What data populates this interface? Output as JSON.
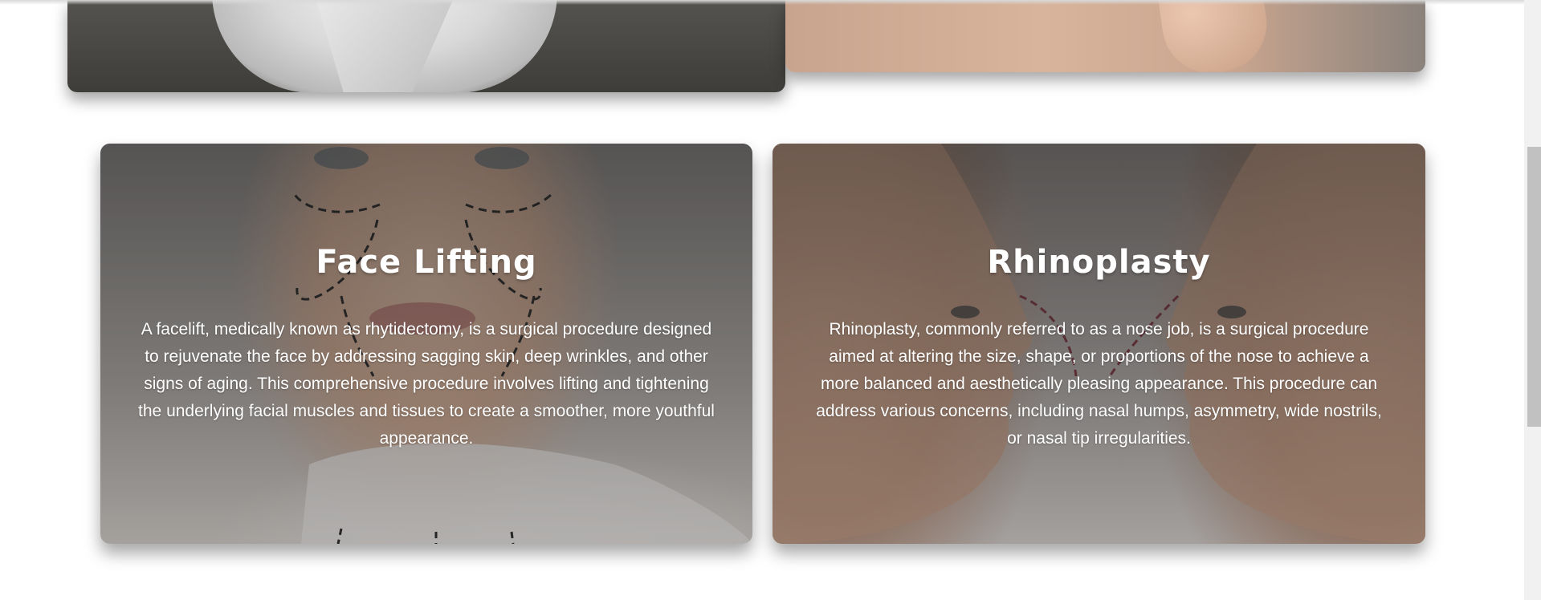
{
  "previous_row": {
    "left_card": {
      "image": "woman-with-towel-photo"
    },
    "right_card": {
      "image": "hand-closeup-photo"
    }
  },
  "cards": [
    {
      "title": "Face Lifting",
      "description": "A facelift, medically known as rhytidectomy, is a surgical procedure designed to rejuvenate the face by addressing sagging skin, deep wrinkles, and other signs of aging. This comprehensive procedure involves lifting and tightening the underlying facial muscles and tissues to create a smoother, more youthful appearance.",
      "image": "face-lift-markings-photo"
    },
    {
      "title": "Rhinoplasty",
      "description": "Rhinoplasty, commonly referred to as a nose job, is a surgical procedure aimed at altering the size, shape, or proportions of the nose to achieve a more balanced and aesthetically pleasing appearance. This procedure can address various concerns, including nasal humps, asymmetry, wide nostrils, or nasal tip irregularities.",
      "image": "two-profiles-nose-photo"
    }
  ],
  "colors": {
    "overlay": "#3a3a3a",
    "text": "#ffffff",
    "marking_line": "#1a1a1a",
    "nose_line": "#7a2a35",
    "scrollbar_thumb": "#c1c1c1"
  }
}
